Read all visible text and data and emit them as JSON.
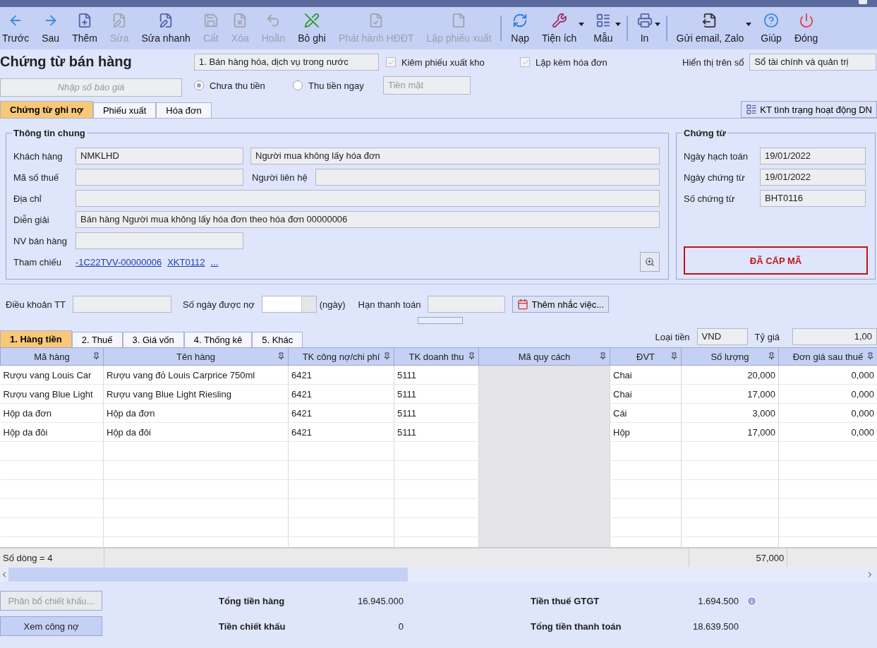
{
  "toolbar": [
    [
      {
        "label": "Trước",
        "disabled": false,
        "dropdown": false
      },
      {
        "label": "Sau",
        "disabled": false,
        "dropdown": false
      },
      {
        "label": "Thêm",
        "disabled": false,
        "dropdown": false
      },
      {
        "label": "Sửa",
        "disabled": true,
        "dropdown": false
      },
      {
        "label": "Sửa nhanh",
        "disabled": false,
        "dropdown": false
      },
      {
        "label": "Cất",
        "disabled": true,
        "dropdown": false
      },
      {
        "label": "Xóa",
        "disabled": true,
        "dropdown": false
      },
      {
        "label": "Hoãn",
        "disabled": true,
        "dropdown": false
      },
      {
        "label": "Bỏ ghi",
        "disabled": false,
        "dropdown": false
      },
      {
        "label": "Phát hành HĐĐT",
        "disabled": true,
        "dropdown": false
      },
      {
        "label": "Lập phiếu xuất",
        "disabled": true,
        "dropdown": false
      }
    ],
    [
      {
        "label": "Nạp",
        "disabled": false,
        "dropdown": false
      },
      {
        "label": "Tiện ích",
        "disabled": false,
        "dropdown": true
      },
      {
        "label": "Mẫu",
        "disabled": false,
        "dropdown": true
      }
    ],
    [
      {
        "label": "In",
        "disabled": false,
        "dropdown": true
      }
    ],
    [
      {
        "label": "Gửi email, Zalo",
        "disabled": false,
        "dropdown": true
      },
      {
        "label": "Giúp",
        "disabled": false,
        "dropdown": false
      },
      {
        "label": "Đóng",
        "disabled": false,
        "dropdown": false
      }
    ]
  ],
  "header": {
    "title": "Chứng từ bán hàng",
    "sale_type": "1. Bán hàng hóa, dịch vụ trong nước",
    "quote_placeholder": "Nhập số báo giá",
    "checkboxes": [
      {
        "label": "Kiêm phiếu xuất kho",
        "checked": true
      },
      {
        "label": "Lập kèm hóa đơn",
        "checked": true
      }
    ],
    "radios": [
      {
        "label": "Chưa thu tiền",
        "selected": true
      },
      {
        "label": "Thu tiền ngay",
        "selected": false
      }
    ],
    "payment_method_placeholder": "Tiền mặt",
    "ledger_label": "Hiển thị trên sổ",
    "ledger_value": "Sổ tài chính và quản trị"
  },
  "doc_tabs": [
    {
      "label": "Chứng từ ghi nợ",
      "selected": true
    },
    {
      "label": "Phiếu xuất",
      "selected": false
    },
    {
      "label": "Hóa đơn",
      "selected": false
    }
  ],
  "check_status_button": "KT tình trạng hoạt động DN",
  "general": {
    "legend": "Thông tin chung",
    "customer_label": "Khách hàng",
    "customer_code": "NMKLHD",
    "customer_name": "Người mua không lấy hóa đơn",
    "tax_code_label": "Mã số thuế",
    "contact_label": "Người liên hệ",
    "address_label": "Địa chỉ",
    "description_label": "Diễn giải",
    "description": "Bán hàng Người mua không lấy hóa đơn theo hóa đơn 00000006",
    "salesperson_label": "NV bán hàng",
    "reference_label": "Tham chiếu",
    "references": [
      "-1C22TVV-00000006",
      "XKT0112",
      "..."
    ]
  },
  "voucher": {
    "legend": "Chứng từ",
    "fields": [
      {
        "label": "Ngày hạch toán",
        "value": "19/01/2022"
      },
      {
        "label": "Ngày chứng từ",
        "value": "19/01/2022"
      },
      {
        "label": "Số chứng từ",
        "value": "BHT0116"
      }
    ],
    "stamp": "ĐÃ CẤP MÃ"
  },
  "terms": {
    "terms_label": "Điều khoản TT",
    "days_label": "Số ngày được nợ",
    "days_unit": "(ngày)",
    "due_label": "Hạn thanh toán",
    "reminder_button": "Thêm nhắc việc..."
  },
  "grid_tabs": [
    {
      "label": "1. Hàng tiền",
      "selected": true
    },
    {
      "label": "2. Thuế",
      "selected": false
    },
    {
      "label": "3. Giá vốn",
      "selected": false
    },
    {
      "label": "4. Thống kê",
      "selected": false
    },
    {
      "label": "5. Khác",
      "selected": false
    }
  ],
  "currency": {
    "label": "Loại tiền",
    "value": "VND",
    "rate_label": "Tỷ giá",
    "rate": "1,00"
  },
  "table": {
    "columns": [
      "Mã hàng",
      "Tên hàng",
      "TK công nợ/chi phí",
      "TK doanh thu",
      "Mã quy cách",
      "ĐVT",
      "Số lượng",
      "Đơn giá sau thuế"
    ],
    "rows": [
      [
        "Rượu vang Louis Car",
        "Rượu vang đỏ Louis Carprice 750ml",
        "6421",
        "5111",
        "",
        "Chai",
        "20,000",
        "0,000"
      ],
      [
        "Rượu vang Blue Light",
        "Rượu vang Blue Light Riesling",
        "6421",
        "5111",
        "",
        "Chai",
        "17,000",
        "0,000"
      ],
      [
        "Hộp da đơn",
        "Hộp da đơn",
        "6421",
        "5111",
        "",
        "Cái",
        "3,000",
        "0,000"
      ],
      [
        "Hộp da đôi",
        "Hộp da đôi",
        "6421",
        "5111",
        "",
        "Hộp",
        "17,000",
        "0,000"
      ]
    ],
    "row_count": "Số dòng = 4",
    "total_quantity": "57,000"
  },
  "footer": {
    "buttons": [
      {
        "label": "Phân bổ chiết khấu...",
        "disabled": true
      },
      {
        "label": "Xem công nợ",
        "disabled": false
      }
    ],
    "totals": [
      {
        "label": "Tổng tiền hàng",
        "value": "16.945.000"
      },
      {
        "label": "Tiền chiết khấu",
        "value": "0"
      },
      {
        "label": "Tiền thuế GTGT",
        "value": "1.694.500"
      },
      {
        "label": "Tổng tiền thanh toán",
        "value": "18.639.500"
      }
    ]
  }
}
